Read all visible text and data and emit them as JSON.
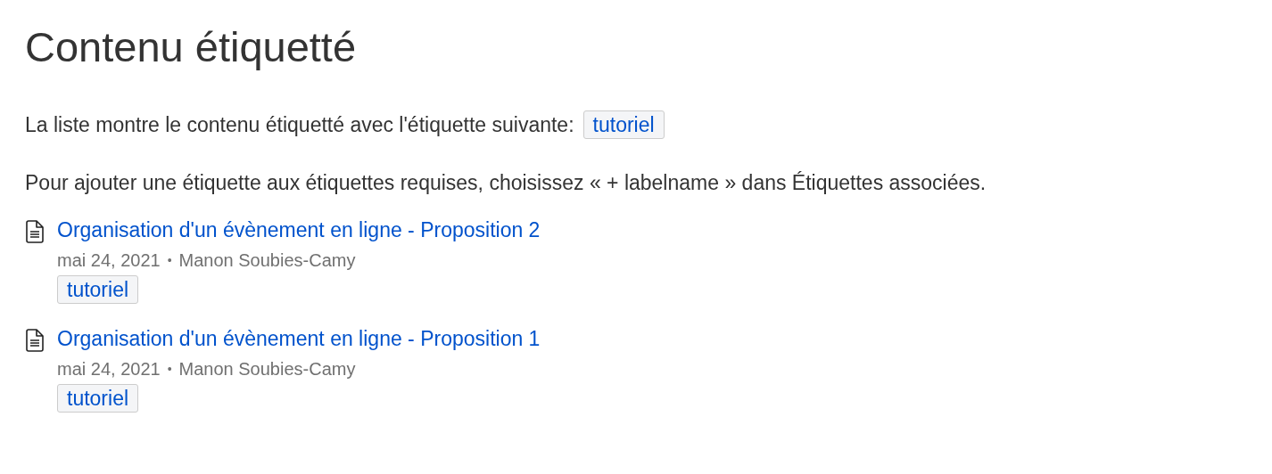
{
  "title": "Contenu étiquetté",
  "intro": {
    "text": "La liste montre le contenu étiquetté avec l'étiquette suivante:",
    "label": "tutoriel"
  },
  "hint": "Pour ajouter une étiquette aux étiquettes requises, choisissez « + labelname » dans Étiquettes associées.",
  "items": [
    {
      "title": "Organisation d'un évènement en ligne - Proposition 2",
      "date": "mai 24, 2021",
      "separator": "•",
      "author": "Manon Soubies-Camy",
      "labels": [
        "tutoriel"
      ]
    },
    {
      "title": "Organisation d'un évènement en ligne - Proposition 1",
      "date": "mai 24, 2021",
      "separator": "•",
      "author": "Manon Soubies-Camy",
      "labels": [
        "tutoriel"
      ]
    }
  ]
}
